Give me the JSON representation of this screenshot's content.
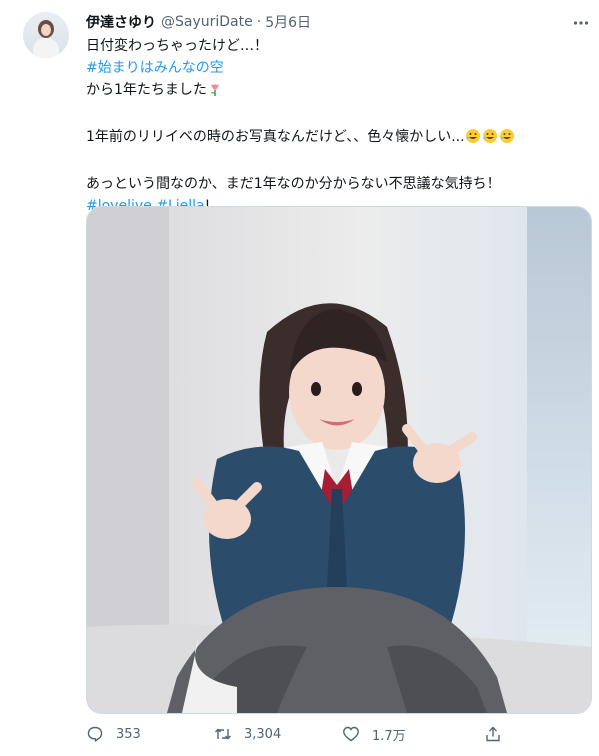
{
  "tweet": {
    "display_name": "伊達さゆり",
    "handle": "@SayuriDate",
    "separator": "·",
    "date": "5月6日",
    "text": {
      "line1": "日付変わっちゃったけど…！",
      "hashtag1": "#始まりはみんなの空",
      "line3": "から1年たちました",
      "line4": "1年前のリリイベの時のお写真なんだけど、、色々懐かしい...",
      "line5": "あっという間なのか、まだ1年なのか分からない不思議な気持ち！",
      "hashtag_lovelive": "#lovelive",
      "hashtag_liella": "#Liella",
      "end_punct": "!"
    },
    "actions": {
      "reply_count": "353",
      "retweet_count": "3,304",
      "like_count": "1.7万"
    }
  },
  "icons": {
    "more": "more-icon",
    "reply": "reply-icon",
    "retweet": "retweet-icon",
    "like": "heart-icon",
    "share": "share-icon",
    "tulip": "tulip-emoji",
    "laugh": "rolling-on-floor-laughing-emoji"
  },
  "colors": {
    "link": "#1d9bf0",
    "secondary": "#536471",
    "text": "#0f1419"
  }
}
